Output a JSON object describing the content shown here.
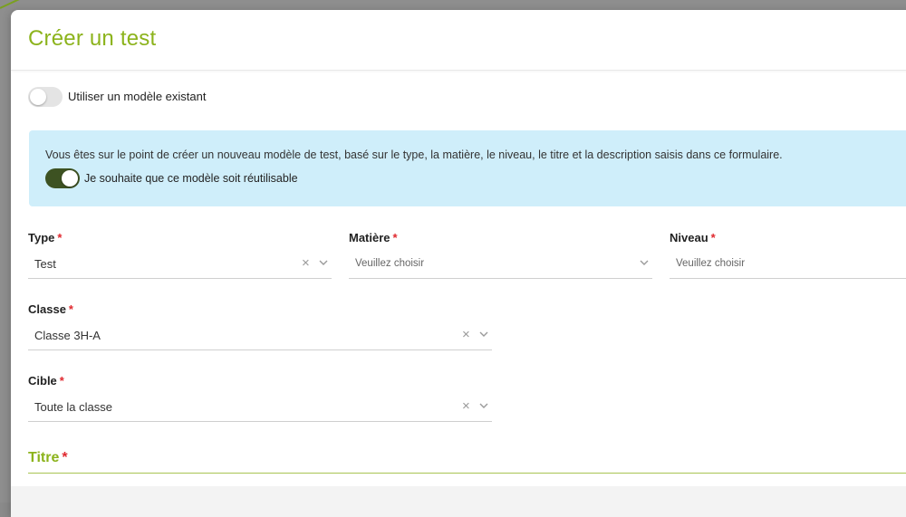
{
  "modal": {
    "title": "Créer un test"
  },
  "use_existing_model": {
    "label": "Utiliser un modèle existant",
    "checked": false
  },
  "info": {
    "text": "Vous êtes sur le point de créer un nouveau modèle de test, basé sur le type, la matière, le niveau, le titre et la description saisis dans ce formulaire.",
    "reusable_label": "Je souhaite que ce modèle soit réutilisable",
    "reusable_checked": true
  },
  "fields": {
    "type": {
      "label": "Type",
      "required_mark": "*",
      "value": "Test"
    },
    "matiere": {
      "label": "Matière",
      "required_mark": "*",
      "placeholder": "Veuillez choisir"
    },
    "niveau": {
      "label": "Niveau",
      "required_mark": "*",
      "placeholder": "Veuillez choisir"
    },
    "classe": {
      "label": "Classe",
      "required_mark": "*",
      "value": "Classe 3H-A"
    },
    "cible": {
      "label": "Cible",
      "required_mark": "*",
      "value": "Toute la classe"
    },
    "titre": {
      "label": "Titre",
      "required_mark": "*"
    }
  },
  "icons": {
    "clear": "×",
    "chevron": "chevron-down-icon"
  },
  "colors": {
    "accent": "#8cb31c",
    "info_bg": "#cfeefa",
    "toggle_on": "#3d5222",
    "required": "#e0282e"
  }
}
